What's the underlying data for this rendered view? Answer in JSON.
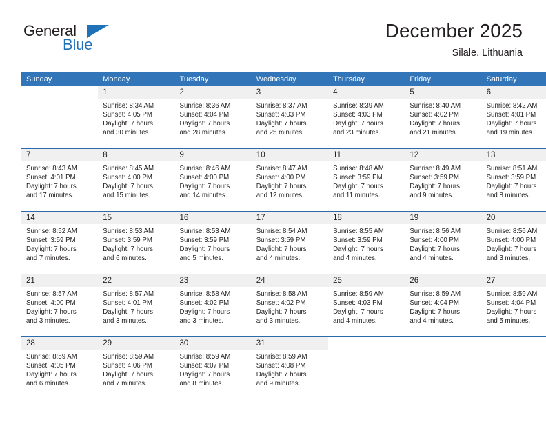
{
  "brand": {
    "name_part1": "General",
    "name_part2": "Blue",
    "flag_icon": "triangle-flag-icon"
  },
  "header": {
    "title": "December 2025",
    "subtitle": "Silale, Lithuania"
  },
  "calendar": {
    "weekday_headers": [
      "Sunday",
      "Monday",
      "Tuesday",
      "Wednesday",
      "Thursday",
      "Friday",
      "Saturday"
    ],
    "accent_color": "#3275b8",
    "separator_color": "#2a6aad",
    "number_band_color": "#f0f0f0",
    "weeks": [
      [
        {
          "day": "",
          "blank": true,
          "lines": []
        },
        {
          "day": "1",
          "lines": [
            "Sunrise: 8:34 AM",
            "Sunset: 4:05 PM",
            "Daylight: 7 hours",
            "and 30 minutes."
          ]
        },
        {
          "day": "2",
          "lines": [
            "Sunrise: 8:36 AM",
            "Sunset: 4:04 PM",
            "Daylight: 7 hours",
            "and 28 minutes."
          ]
        },
        {
          "day": "3",
          "lines": [
            "Sunrise: 8:37 AM",
            "Sunset: 4:03 PM",
            "Daylight: 7 hours",
            "and 25 minutes."
          ]
        },
        {
          "day": "4",
          "lines": [
            "Sunrise: 8:39 AM",
            "Sunset: 4:03 PM",
            "Daylight: 7 hours",
            "and 23 minutes."
          ]
        },
        {
          "day": "5",
          "lines": [
            "Sunrise: 8:40 AM",
            "Sunset: 4:02 PM",
            "Daylight: 7 hours",
            "and 21 minutes."
          ]
        },
        {
          "day": "6",
          "lines": [
            "Sunrise: 8:42 AM",
            "Sunset: 4:01 PM",
            "Daylight: 7 hours",
            "and 19 minutes."
          ]
        }
      ],
      [
        {
          "day": "7",
          "lines": [
            "Sunrise: 8:43 AM",
            "Sunset: 4:01 PM",
            "Daylight: 7 hours",
            "and 17 minutes."
          ]
        },
        {
          "day": "8",
          "lines": [
            "Sunrise: 8:45 AM",
            "Sunset: 4:00 PM",
            "Daylight: 7 hours",
            "and 15 minutes."
          ]
        },
        {
          "day": "9",
          "lines": [
            "Sunrise: 8:46 AM",
            "Sunset: 4:00 PM",
            "Daylight: 7 hours",
            "and 14 minutes."
          ]
        },
        {
          "day": "10",
          "lines": [
            "Sunrise: 8:47 AM",
            "Sunset: 4:00 PM",
            "Daylight: 7 hours",
            "and 12 minutes."
          ]
        },
        {
          "day": "11",
          "lines": [
            "Sunrise: 8:48 AM",
            "Sunset: 3:59 PM",
            "Daylight: 7 hours",
            "and 11 minutes."
          ]
        },
        {
          "day": "12",
          "lines": [
            "Sunrise: 8:49 AM",
            "Sunset: 3:59 PM",
            "Daylight: 7 hours",
            "and 9 minutes."
          ]
        },
        {
          "day": "13",
          "lines": [
            "Sunrise: 8:51 AM",
            "Sunset: 3:59 PM",
            "Daylight: 7 hours",
            "and 8 minutes."
          ]
        }
      ],
      [
        {
          "day": "14",
          "lines": [
            "Sunrise: 8:52 AM",
            "Sunset: 3:59 PM",
            "Daylight: 7 hours",
            "and 7 minutes."
          ]
        },
        {
          "day": "15",
          "lines": [
            "Sunrise: 8:53 AM",
            "Sunset: 3:59 PM",
            "Daylight: 7 hours",
            "and 6 minutes."
          ]
        },
        {
          "day": "16",
          "lines": [
            "Sunrise: 8:53 AM",
            "Sunset: 3:59 PM",
            "Daylight: 7 hours",
            "and 5 minutes."
          ]
        },
        {
          "day": "17",
          "lines": [
            "Sunrise: 8:54 AM",
            "Sunset: 3:59 PM",
            "Daylight: 7 hours",
            "and 4 minutes."
          ]
        },
        {
          "day": "18",
          "lines": [
            "Sunrise: 8:55 AM",
            "Sunset: 3:59 PM",
            "Daylight: 7 hours",
            "and 4 minutes."
          ]
        },
        {
          "day": "19",
          "lines": [
            "Sunrise: 8:56 AM",
            "Sunset: 4:00 PM",
            "Daylight: 7 hours",
            "and 4 minutes."
          ]
        },
        {
          "day": "20",
          "lines": [
            "Sunrise: 8:56 AM",
            "Sunset: 4:00 PM",
            "Daylight: 7 hours",
            "and 3 minutes."
          ]
        }
      ],
      [
        {
          "day": "21",
          "lines": [
            "Sunrise: 8:57 AM",
            "Sunset: 4:00 PM",
            "Daylight: 7 hours",
            "and 3 minutes."
          ]
        },
        {
          "day": "22",
          "lines": [
            "Sunrise: 8:57 AM",
            "Sunset: 4:01 PM",
            "Daylight: 7 hours",
            "and 3 minutes."
          ]
        },
        {
          "day": "23",
          "lines": [
            "Sunrise: 8:58 AM",
            "Sunset: 4:02 PM",
            "Daylight: 7 hours",
            "and 3 minutes."
          ]
        },
        {
          "day": "24",
          "lines": [
            "Sunrise: 8:58 AM",
            "Sunset: 4:02 PM",
            "Daylight: 7 hours",
            "and 3 minutes."
          ]
        },
        {
          "day": "25",
          "lines": [
            "Sunrise: 8:59 AM",
            "Sunset: 4:03 PM",
            "Daylight: 7 hours",
            "and 4 minutes."
          ]
        },
        {
          "day": "26",
          "lines": [
            "Sunrise: 8:59 AM",
            "Sunset: 4:04 PM",
            "Daylight: 7 hours",
            "and 4 minutes."
          ]
        },
        {
          "day": "27",
          "lines": [
            "Sunrise: 8:59 AM",
            "Sunset: 4:04 PM",
            "Daylight: 7 hours",
            "and 5 minutes."
          ]
        }
      ],
      [
        {
          "day": "28",
          "lines": [
            "Sunrise: 8:59 AM",
            "Sunset: 4:05 PM",
            "Daylight: 7 hours",
            "and 6 minutes."
          ]
        },
        {
          "day": "29",
          "lines": [
            "Sunrise: 8:59 AM",
            "Sunset: 4:06 PM",
            "Daylight: 7 hours",
            "and 7 minutes."
          ]
        },
        {
          "day": "30",
          "lines": [
            "Sunrise: 8:59 AM",
            "Sunset: 4:07 PM",
            "Daylight: 7 hours",
            "and 8 minutes."
          ]
        },
        {
          "day": "31",
          "lines": [
            "Sunrise: 8:59 AM",
            "Sunset: 4:08 PM",
            "Daylight: 7 hours",
            "and 9 minutes."
          ]
        },
        {
          "day": "",
          "blank": true,
          "lines": []
        },
        {
          "day": "",
          "blank": true,
          "lines": []
        },
        {
          "day": "",
          "blank": true,
          "lines": []
        }
      ]
    ]
  }
}
